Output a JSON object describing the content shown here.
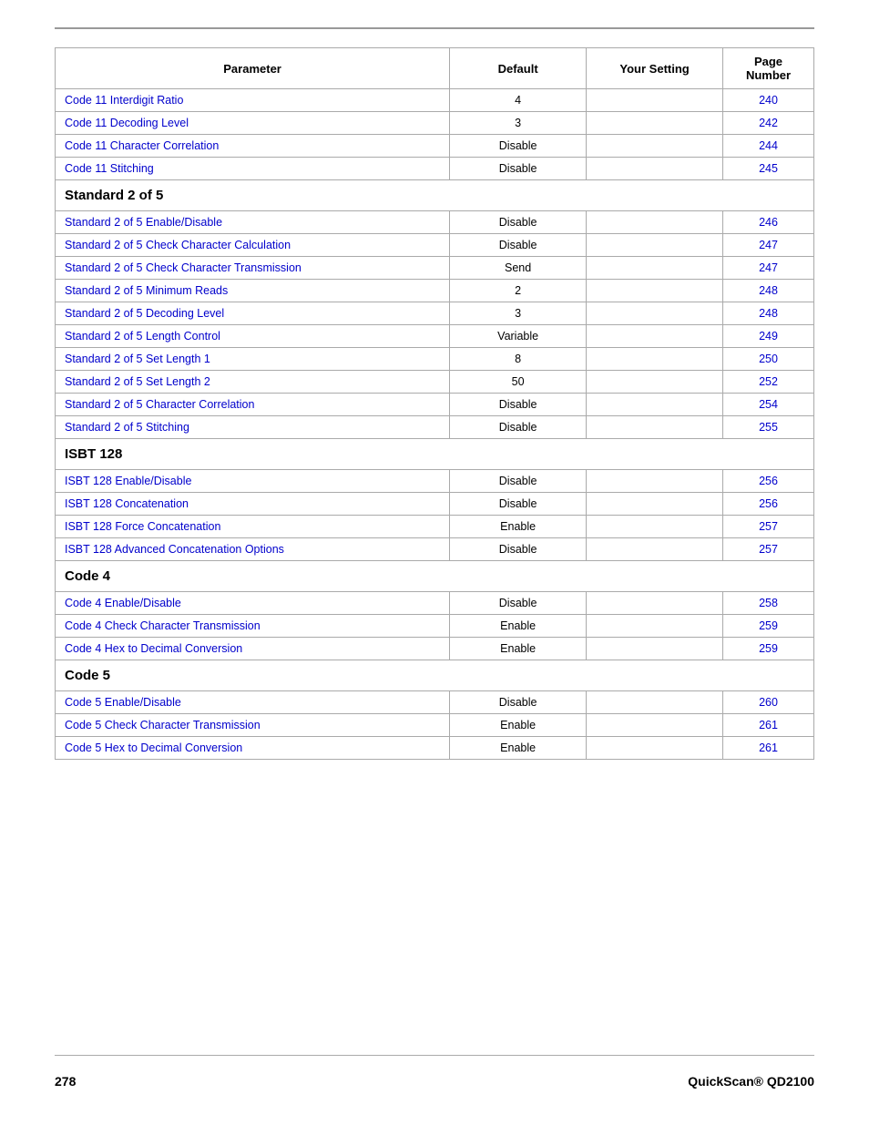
{
  "header": {
    "columns": [
      "Parameter",
      "Default",
      "Your Setting",
      "Page Number"
    ]
  },
  "rows": [
    {
      "type": "data",
      "param": "Code 11 Interdigit Ratio",
      "default": "4",
      "page": "240"
    },
    {
      "type": "data",
      "param": "Code 11 Decoding Level",
      "default": "3",
      "page": "242"
    },
    {
      "type": "data",
      "param": "Code 11 Character Correlation",
      "default": "Disable",
      "page": "244"
    },
    {
      "type": "data",
      "param": "Code 11 Stitching",
      "default": "Disable",
      "page": "245"
    },
    {
      "type": "section",
      "label": "Standard 2 of 5"
    },
    {
      "type": "data",
      "param": "Standard 2 of 5 Enable/Disable",
      "default": "Disable",
      "page": "246"
    },
    {
      "type": "data",
      "param": "Standard 2 of 5 Check Character Calculation",
      "default": "Disable",
      "page": "247"
    },
    {
      "type": "data",
      "param": "Standard 2 of 5 Check Character Transmission",
      "default": "Send",
      "page": "247"
    },
    {
      "type": "data",
      "param": "Standard 2 of 5 Minimum Reads",
      "default": "2",
      "page": "248"
    },
    {
      "type": "data",
      "param": "Standard 2 of 5 Decoding Level",
      "default": "3",
      "page": "248"
    },
    {
      "type": "data",
      "param": "Standard 2 of 5 Length Control",
      "default": "Variable",
      "page": "249"
    },
    {
      "type": "data",
      "param": "Standard 2 of 5 Set Length 1",
      "default": "8",
      "page": "250"
    },
    {
      "type": "data",
      "param": "Standard 2 of 5 Set Length 2",
      "default": "50",
      "page": "252"
    },
    {
      "type": "data",
      "param": "Standard 2 of 5 Character Correlation",
      "default": "Disable",
      "page": "254"
    },
    {
      "type": "data",
      "param": "Standard 2 of 5 Stitching",
      "default": "Disable",
      "page": "255"
    },
    {
      "type": "section",
      "label": "ISBT 128"
    },
    {
      "type": "data",
      "param": "ISBT 128 Enable/Disable",
      "default": "Disable",
      "page": "256"
    },
    {
      "type": "data",
      "param": "ISBT 128 Concatenation",
      "default": "Disable",
      "page": "256"
    },
    {
      "type": "data",
      "param": "ISBT 128 Force Concatenation",
      "default": "Enable",
      "page": "257"
    },
    {
      "type": "data",
      "param": "ISBT 128 Advanced Concatenation Options",
      "default": "Disable",
      "page": "257"
    },
    {
      "type": "section",
      "label": "Code 4"
    },
    {
      "type": "data",
      "param": "Code 4 Enable/Disable",
      "default": "Disable",
      "page": "258"
    },
    {
      "type": "data",
      "param": "Code 4 Check Character Transmission",
      "default": "Enable",
      "page": "259"
    },
    {
      "type": "data",
      "param": "Code 4 Hex to Decimal Conversion",
      "default": "Enable",
      "page": "259"
    },
    {
      "type": "section",
      "label": "Code 5"
    },
    {
      "type": "data",
      "param": "Code 5 Enable/Disable",
      "default": "Disable",
      "page": "260"
    },
    {
      "type": "data",
      "param": "Code 5 Check Character Transmission",
      "default": "Enable",
      "page": "261"
    },
    {
      "type": "data",
      "param": "Code 5 Hex to Decimal Conversion",
      "default": "Enable",
      "page": "261"
    }
  ],
  "footer": {
    "left": "278",
    "right": "QuickScan® QD2100"
  }
}
